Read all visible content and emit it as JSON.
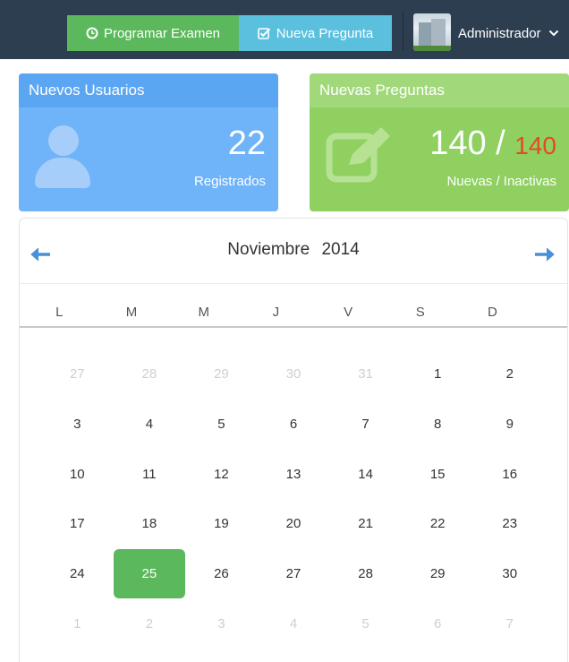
{
  "topbar": {
    "program_button": "Programar Examen",
    "new_question_button": "Nueva Pregunta",
    "user_name": "Administrador"
  },
  "cards": {
    "users": {
      "title": "Nuevos Usuarios",
      "count": "22",
      "subtitle": "Registrados",
      "color": "#6fb3f8"
    },
    "questions": {
      "title": "Nuevas Preguntas",
      "count": "140",
      "separator": " / ",
      "inactive": "140",
      "subtitle": "Nuevas / Inactivas",
      "color": "#8fd061"
    }
  },
  "calendar": {
    "month": "Noviembre",
    "year": "2014",
    "weekdays": [
      "L",
      "M",
      "M",
      "J",
      "V",
      "S",
      "D"
    ],
    "today": "25",
    "weeks": [
      [
        {
          "d": "27",
          "other": true
        },
        {
          "d": "28",
          "other": true
        },
        {
          "d": "29",
          "other": true
        },
        {
          "d": "30",
          "other": true
        },
        {
          "d": "31",
          "other": true
        },
        {
          "d": "1"
        },
        {
          "d": "2"
        }
      ],
      [
        {
          "d": "3"
        },
        {
          "d": "4"
        },
        {
          "d": "5"
        },
        {
          "d": "6"
        },
        {
          "d": "7"
        },
        {
          "d": "8"
        },
        {
          "d": "9"
        }
      ],
      [
        {
          "d": "10"
        },
        {
          "d": "11"
        },
        {
          "d": "12"
        },
        {
          "d": "13"
        },
        {
          "d": "14"
        },
        {
          "d": "15"
        },
        {
          "d": "16"
        }
      ],
      [
        {
          "d": "17"
        },
        {
          "d": "18"
        },
        {
          "d": "19"
        },
        {
          "d": "20"
        },
        {
          "d": "21"
        },
        {
          "d": "22"
        },
        {
          "d": "23"
        }
      ],
      [
        {
          "d": "24"
        },
        {
          "d": "25",
          "today": true
        },
        {
          "d": "26"
        },
        {
          "d": "27"
        },
        {
          "d": "28"
        },
        {
          "d": "29"
        },
        {
          "d": "30"
        }
      ],
      [
        {
          "d": "1",
          "other": true
        },
        {
          "d": "2",
          "other": true
        },
        {
          "d": "3",
          "other": true
        },
        {
          "d": "4",
          "other": true
        },
        {
          "d": "5",
          "other": true
        },
        {
          "d": "6",
          "other": true
        },
        {
          "d": "7",
          "other": true
        }
      ]
    ]
  },
  "icons": {
    "program": "clock-icon",
    "new_question": "check-square-icon",
    "user_menu": "chevron-down-icon",
    "users_card": "user-icon",
    "questions_card": "edit-icon",
    "prev": "arrow-left-icon",
    "next": "arrow-right-icon"
  }
}
